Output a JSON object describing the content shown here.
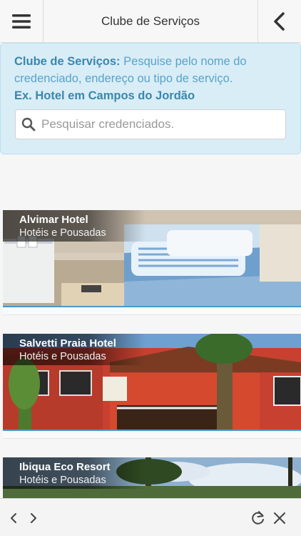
{
  "header": {
    "title": "Clube de Serviços",
    "menu_icon": "hamburger-menu-icon",
    "back_icon": "chevron-left-icon"
  },
  "info": {
    "label": "Clube de Serviços:",
    "description": " Pesquise pelo nome do credenciado, endereço ou tipo de serviço.",
    "example": "Ex. Hotel em Campos do Jordão",
    "search_placeholder": "Pesquisar credenciados.",
    "search_value": ""
  },
  "cards": [
    {
      "title": "Alvimar Hotel",
      "category": "Hotéis e Pousadas"
    },
    {
      "title": "Salvetti Praia Hotel",
      "category": "Hotéis e Pousadas"
    },
    {
      "title": "Ibiqua Eco Resort",
      "category": "Hotéis e Pousadas"
    }
  ],
  "bottom_bar": {
    "icons": [
      "back-arrow-icon",
      "forward-arrow-icon",
      "reload-icon",
      "close-icon"
    ]
  },
  "colors": {
    "accent": "#3a87ad",
    "info_bg": "#d9edf7",
    "underline": "#4a9bc9"
  }
}
